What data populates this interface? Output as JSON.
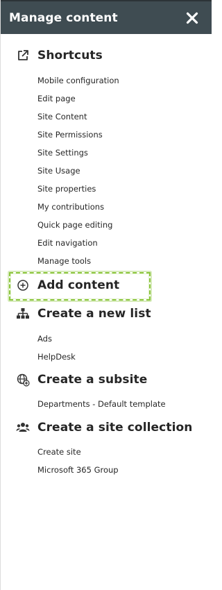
{
  "header": {
    "title": "Manage content",
    "close_icon": "close-icon"
  },
  "sections": {
    "shortcuts": {
      "title": "Shortcuts",
      "icon": "external-link-icon",
      "items": [
        "Mobile configuration",
        "Edit page",
        "Site Content",
        "Site Permissions",
        "Site Settings",
        "Site Usage",
        "Site properties",
        "My contributions",
        "Quick page editing",
        "Edit navigation",
        "Manage tools"
      ]
    },
    "add_content": {
      "title": "Add content",
      "icon": "plus-circle-icon",
      "highlight_color": "#8dc63f"
    },
    "create_list": {
      "title": "Create a new list",
      "icon": "sitemap-icon",
      "items": [
        "Ads",
        "HelpDesk"
      ]
    },
    "create_subsite": {
      "title": "Create a subsite",
      "icon": "globe-plus-icon",
      "items": [
        "Departments - Default template"
      ]
    },
    "create_collection": {
      "title": "Create a site collection",
      "icon": "users-icon",
      "items": [
        "Create site",
        "Microsoft 365 Group"
      ]
    }
  },
  "colors": {
    "header_bg": "#3f4c52",
    "text": "#262626",
    "highlight": "#8dc63f"
  }
}
